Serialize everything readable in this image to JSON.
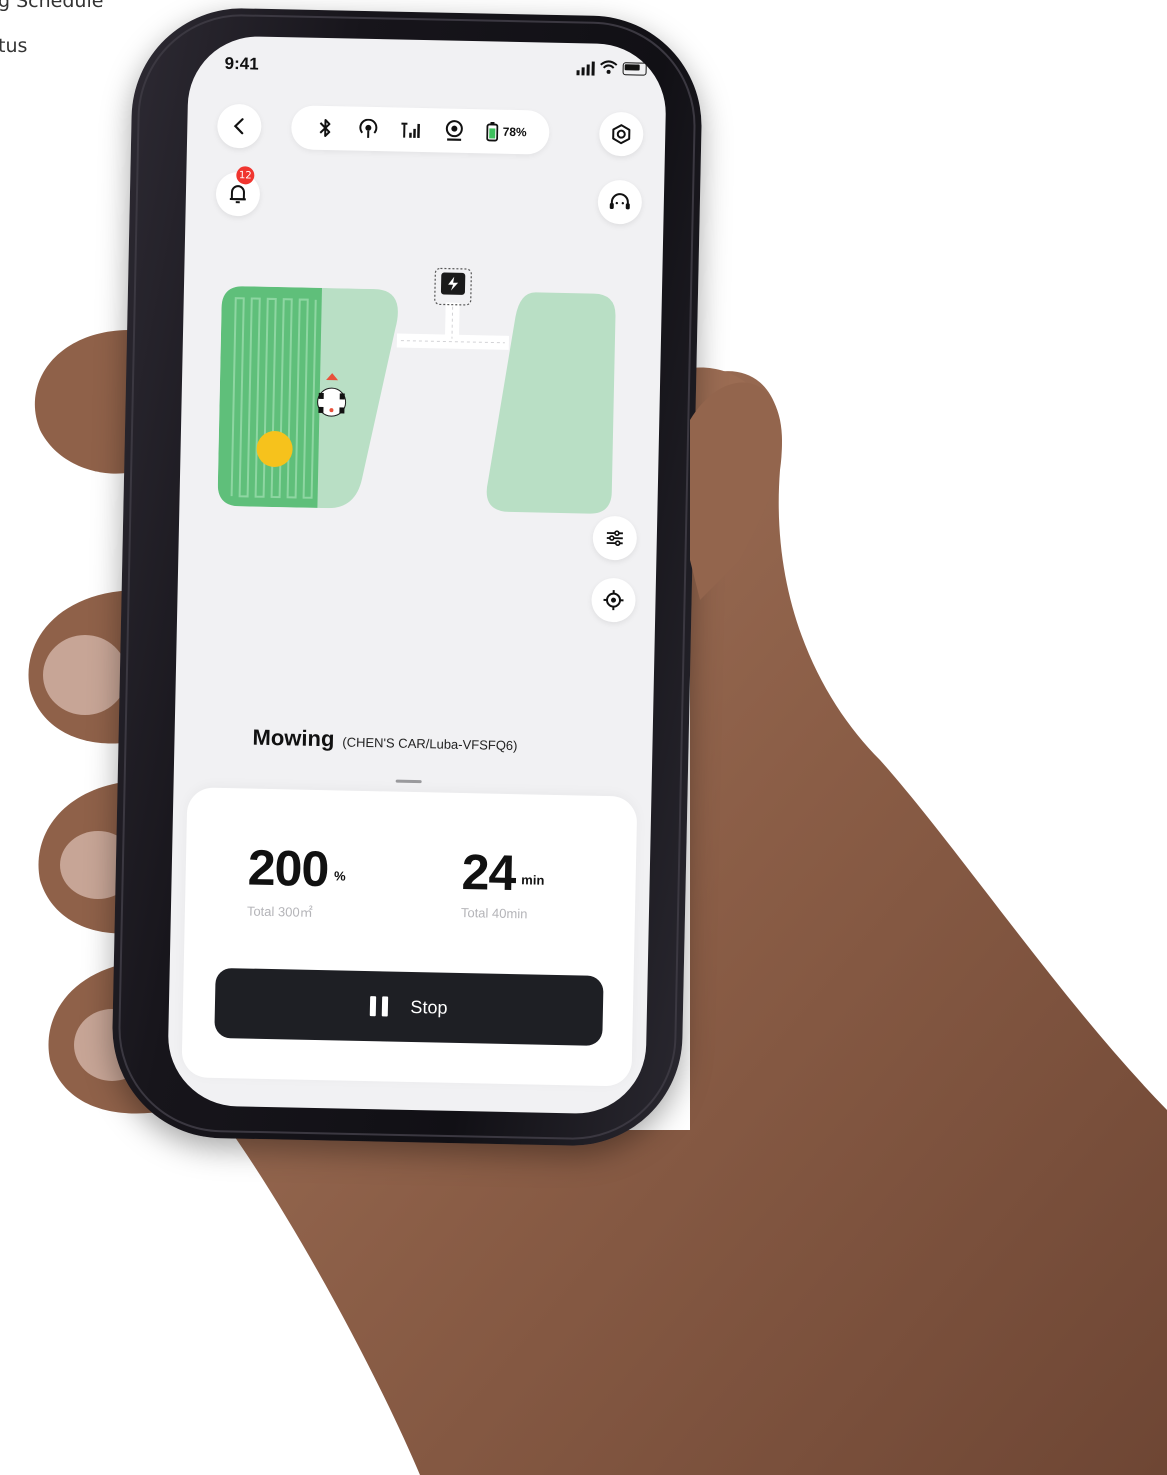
{
  "page_text": {
    "line1": "g Schedule",
    "line2": "tus"
  },
  "status_bar": {
    "time": "9:41"
  },
  "top_bar": {
    "battery_percent": "78%",
    "notification_count": "12"
  },
  "task": {
    "title": "Mowing",
    "subtitle": "(CHEN'S CAR/Luba-VFSFQ6)"
  },
  "stats": {
    "progress_value": "200",
    "progress_unit": "%",
    "progress_total": "Total 300㎡",
    "time_value": "24",
    "time_unit": "min",
    "time_total": "Total 40min"
  },
  "actions": {
    "stop_label": "Stop"
  },
  "colors": {
    "lawn_mowed": "#5fbf7a",
    "lawn_unmowed": "#b9dfc5",
    "obstacle": "#f6c21c",
    "button_dark": "#1e1f24"
  },
  "icons": [
    "back-icon",
    "bluetooth-icon",
    "rtk-icon",
    "cellular-icon",
    "camera-icon",
    "battery-icon",
    "settings-icon",
    "bell-icon",
    "support-icon",
    "charging-station-icon",
    "filter-icon",
    "locate-icon",
    "pause-icon"
  ]
}
